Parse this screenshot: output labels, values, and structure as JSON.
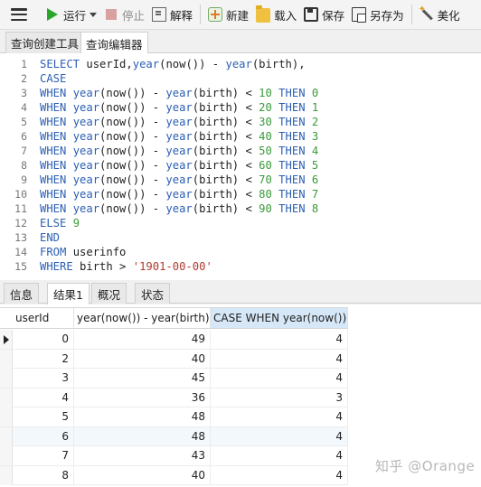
{
  "toolbar": {
    "run_label": "运行",
    "stop_label": "停止",
    "explain_label": "解释",
    "new_label": "新建",
    "load_label": "载入",
    "save_label": "保存",
    "saveas_label": "另存为",
    "beautify_label": "美化"
  },
  "tabs": [
    {
      "label": "查询创建工具"
    },
    {
      "label": "查询编辑器"
    }
  ],
  "editor": {
    "line_numbers": [
      "1",
      "2",
      "3",
      "4",
      "5",
      "6",
      "7",
      "8",
      "9",
      "10",
      "11",
      "12",
      "13",
      "14",
      "15"
    ],
    "lines": [
      [
        {
          "t": "SELECT ",
          "c": "kw"
        },
        {
          "t": "userId,",
          "c": "id"
        },
        {
          "t": "year",
          "c": "fn"
        },
        {
          "t": "(now()) - ",
          "c": "id"
        },
        {
          "t": "year",
          "c": "fn"
        },
        {
          "t": "(birth),",
          "c": "id"
        }
      ],
      [
        {
          "t": "CASE",
          "c": "kw"
        }
      ],
      [
        {
          "t": "WHEN ",
          "c": "kw"
        },
        {
          "t": "year",
          "c": "fn"
        },
        {
          "t": "(now()) - ",
          "c": "id"
        },
        {
          "t": "year",
          "c": "fn"
        },
        {
          "t": "(birth) < ",
          "c": "id"
        },
        {
          "t": "10",
          "c": "num"
        },
        {
          "t": " THEN ",
          "c": "kw"
        },
        {
          "t": "0",
          "c": "num"
        }
      ],
      [
        {
          "t": "WHEN ",
          "c": "kw"
        },
        {
          "t": "year",
          "c": "fn"
        },
        {
          "t": "(now()) - ",
          "c": "id"
        },
        {
          "t": "year",
          "c": "fn"
        },
        {
          "t": "(birth) < ",
          "c": "id"
        },
        {
          "t": "20",
          "c": "num"
        },
        {
          "t": " THEN ",
          "c": "kw"
        },
        {
          "t": "1",
          "c": "num"
        }
      ],
      [
        {
          "t": "WHEN ",
          "c": "kw"
        },
        {
          "t": "year",
          "c": "fn"
        },
        {
          "t": "(now()) - ",
          "c": "id"
        },
        {
          "t": "year",
          "c": "fn"
        },
        {
          "t": "(birth) < ",
          "c": "id"
        },
        {
          "t": "30",
          "c": "num"
        },
        {
          "t": " THEN ",
          "c": "kw"
        },
        {
          "t": "2",
          "c": "num"
        }
      ],
      [
        {
          "t": "WHEN ",
          "c": "kw"
        },
        {
          "t": "year",
          "c": "fn"
        },
        {
          "t": "(now()) - ",
          "c": "id"
        },
        {
          "t": "year",
          "c": "fn"
        },
        {
          "t": "(birth) < ",
          "c": "id"
        },
        {
          "t": "40",
          "c": "num"
        },
        {
          "t": " THEN ",
          "c": "kw"
        },
        {
          "t": "3",
          "c": "num"
        }
      ],
      [
        {
          "t": "WHEN ",
          "c": "kw"
        },
        {
          "t": "year",
          "c": "fn"
        },
        {
          "t": "(now()) - ",
          "c": "id"
        },
        {
          "t": "year",
          "c": "fn"
        },
        {
          "t": "(birth) < ",
          "c": "id"
        },
        {
          "t": "50",
          "c": "num"
        },
        {
          "t": " THEN ",
          "c": "kw"
        },
        {
          "t": "4",
          "c": "num"
        }
      ],
      [
        {
          "t": "WHEN ",
          "c": "kw"
        },
        {
          "t": "year",
          "c": "fn"
        },
        {
          "t": "(now()) - ",
          "c": "id"
        },
        {
          "t": "year",
          "c": "fn"
        },
        {
          "t": "(birth) < ",
          "c": "id"
        },
        {
          "t": "60",
          "c": "num"
        },
        {
          "t": " THEN ",
          "c": "kw"
        },
        {
          "t": "5",
          "c": "num"
        }
      ],
      [
        {
          "t": "WHEN ",
          "c": "kw"
        },
        {
          "t": "year",
          "c": "fn"
        },
        {
          "t": "(now()) - ",
          "c": "id"
        },
        {
          "t": "year",
          "c": "fn"
        },
        {
          "t": "(birth) < ",
          "c": "id"
        },
        {
          "t": "70",
          "c": "num"
        },
        {
          "t": " THEN ",
          "c": "kw"
        },
        {
          "t": "6",
          "c": "num"
        }
      ],
      [
        {
          "t": "WHEN ",
          "c": "kw"
        },
        {
          "t": "year",
          "c": "fn"
        },
        {
          "t": "(now()) - ",
          "c": "id"
        },
        {
          "t": "year",
          "c": "fn"
        },
        {
          "t": "(birth) < ",
          "c": "id"
        },
        {
          "t": "80",
          "c": "num"
        },
        {
          "t": " THEN ",
          "c": "kw"
        },
        {
          "t": "7",
          "c": "num"
        }
      ],
      [
        {
          "t": "WHEN ",
          "c": "kw"
        },
        {
          "t": "year",
          "c": "fn"
        },
        {
          "t": "(now()) - ",
          "c": "id"
        },
        {
          "t": "year",
          "c": "fn"
        },
        {
          "t": "(birth) < ",
          "c": "id"
        },
        {
          "t": "90",
          "c": "num"
        },
        {
          "t": " THEN ",
          "c": "kw"
        },
        {
          "t": "8",
          "c": "num"
        }
      ],
      [
        {
          "t": "ELSE ",
          "c": "kw"
        },
        {
          "t": "9",
          "c": "num"
        }
      ],
      [
        {
          "t": "END",
          "c": "kw"
        }
      ],
      [
        {
          "t": "FROM ",
          "c": "kw"
        },
        {
          "t": "userinfo",
          "c": "id"
        }
      ],
      [
        {
          "t": "WHERE ",
          "c": "kw"
        },
        {
          "t": "birth > ",
          "c": "id"
        },
        {
          "t": "'1901-00-00'",
          "c": "str"
        }
      ]
    ]
  },
  "result_tabs": [
    {
      "label": "信息"
    },
    {
      "label": "结果1"
    },
    {
      "label": "概况"
    },
    {
      "label": "状态"
    }
  ],
  "grid": {
    "columns": [
      "userId",
      "year(now()) - year(birth)",
      "CASE WHEN year(now()) -"
    ],
    "rows": [
      [
        "0",
        "49",
        "4"
      ],
      [
        "2",
        "40",
        "4"
      ],
      [
        "3",
        "45",
        "4"
      ],
      [
        "4",
        "36",
        "3"
      ],
      [
        "5",
        "48",
        "4"
      ],
      [
        "6",
        "48",
        "4"
      ],
      [
        "7",
        "43",
        "4"
      ],
      [
        "8",
        "40",
        "4"
      ]
    ]
  },
  "watermark": "知乎 @Orange"
}
